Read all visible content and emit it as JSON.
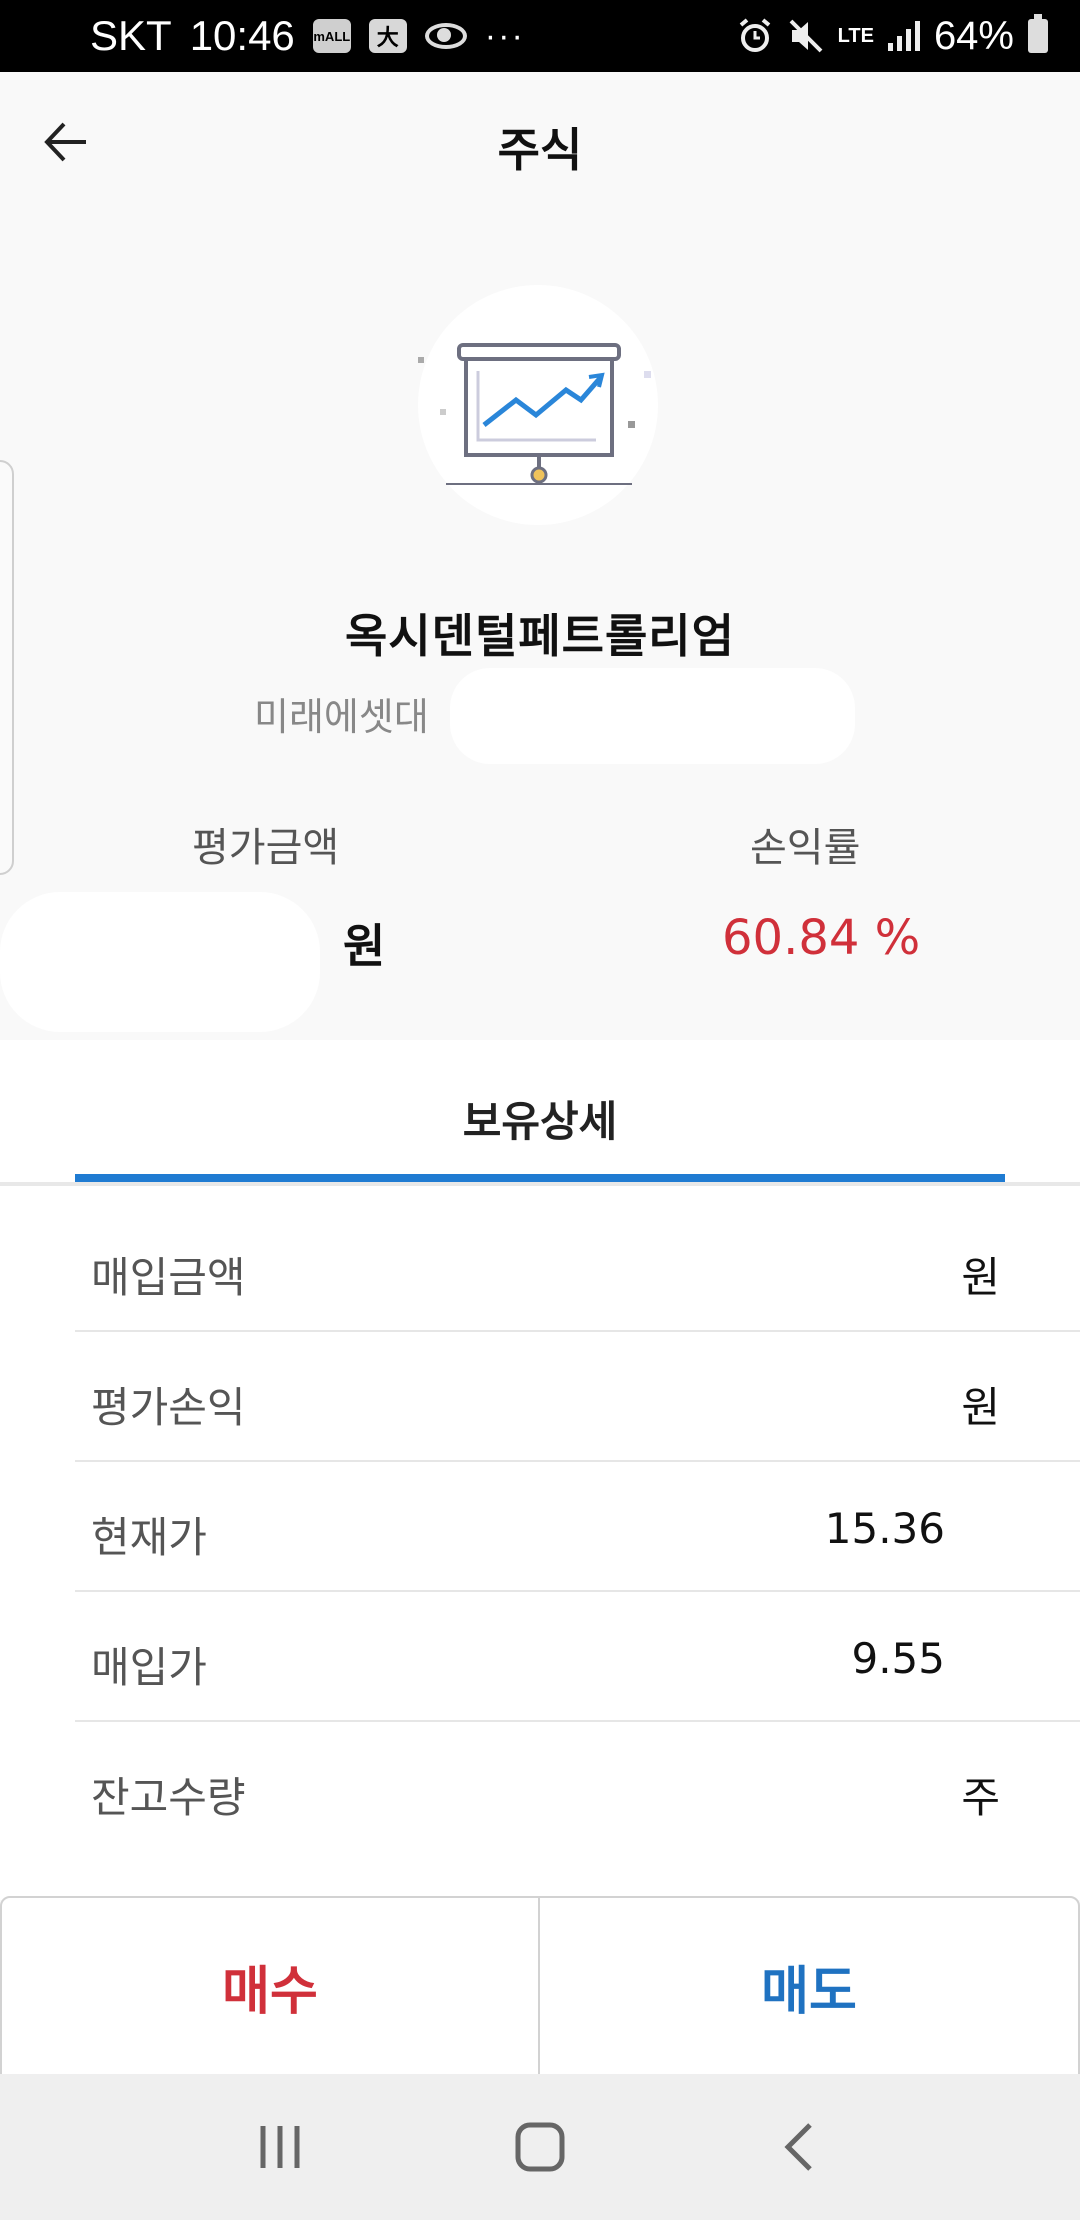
{
  "status_bar": {
    "carrier": "SKT",
    "time": "10:46",
    "left_icons": [
      "mall-app-icon",
      "dictionary-icon",
      "saturn-icon"
    ],
    "more": "···",
    "network": "LTE",
    "battery": "64%"
  },
  "header": {
    "title": "주식",
    "back_icon": "arrow-left-icon"
  },
  "stock": {
    "name": "옥시덴털페트롤리엄",
    "account_visible": "미래에셋대",
    "valuation_label": "평가금액",
    "valuation_unit": "원",
    "profit_rate_label": "손익률",
    "profit_rate": "60.84 %",
    "profit_color": "#d0303a"
  },
  "tab": {
    "label": "보유상세",
    "accent": "#1f7bd2"
  },
  "details": [
    {
      "label": "매입금액",
      "value": "원"
    },
    {
      "label": "평가손익",
      "value": "원"
    },
    {
      "label": "현재가",
      "value": "15.36"
    },
    {
      "label": "매입가",
      "value": "9.55"
    },
    {
      "label": "잔고수량",
      "value": "주"
    }
  ],
  "actions": {
    "buy": "매수",
    "sell": "매도",
    "buy_color": "#d0303a",
    "sell_color": "#1f72c1"
  },
  "navbar": {
    "items": [
      "recent-apps-icon",
      "home-icon",
      "back-icon"
    ]
  }
}
